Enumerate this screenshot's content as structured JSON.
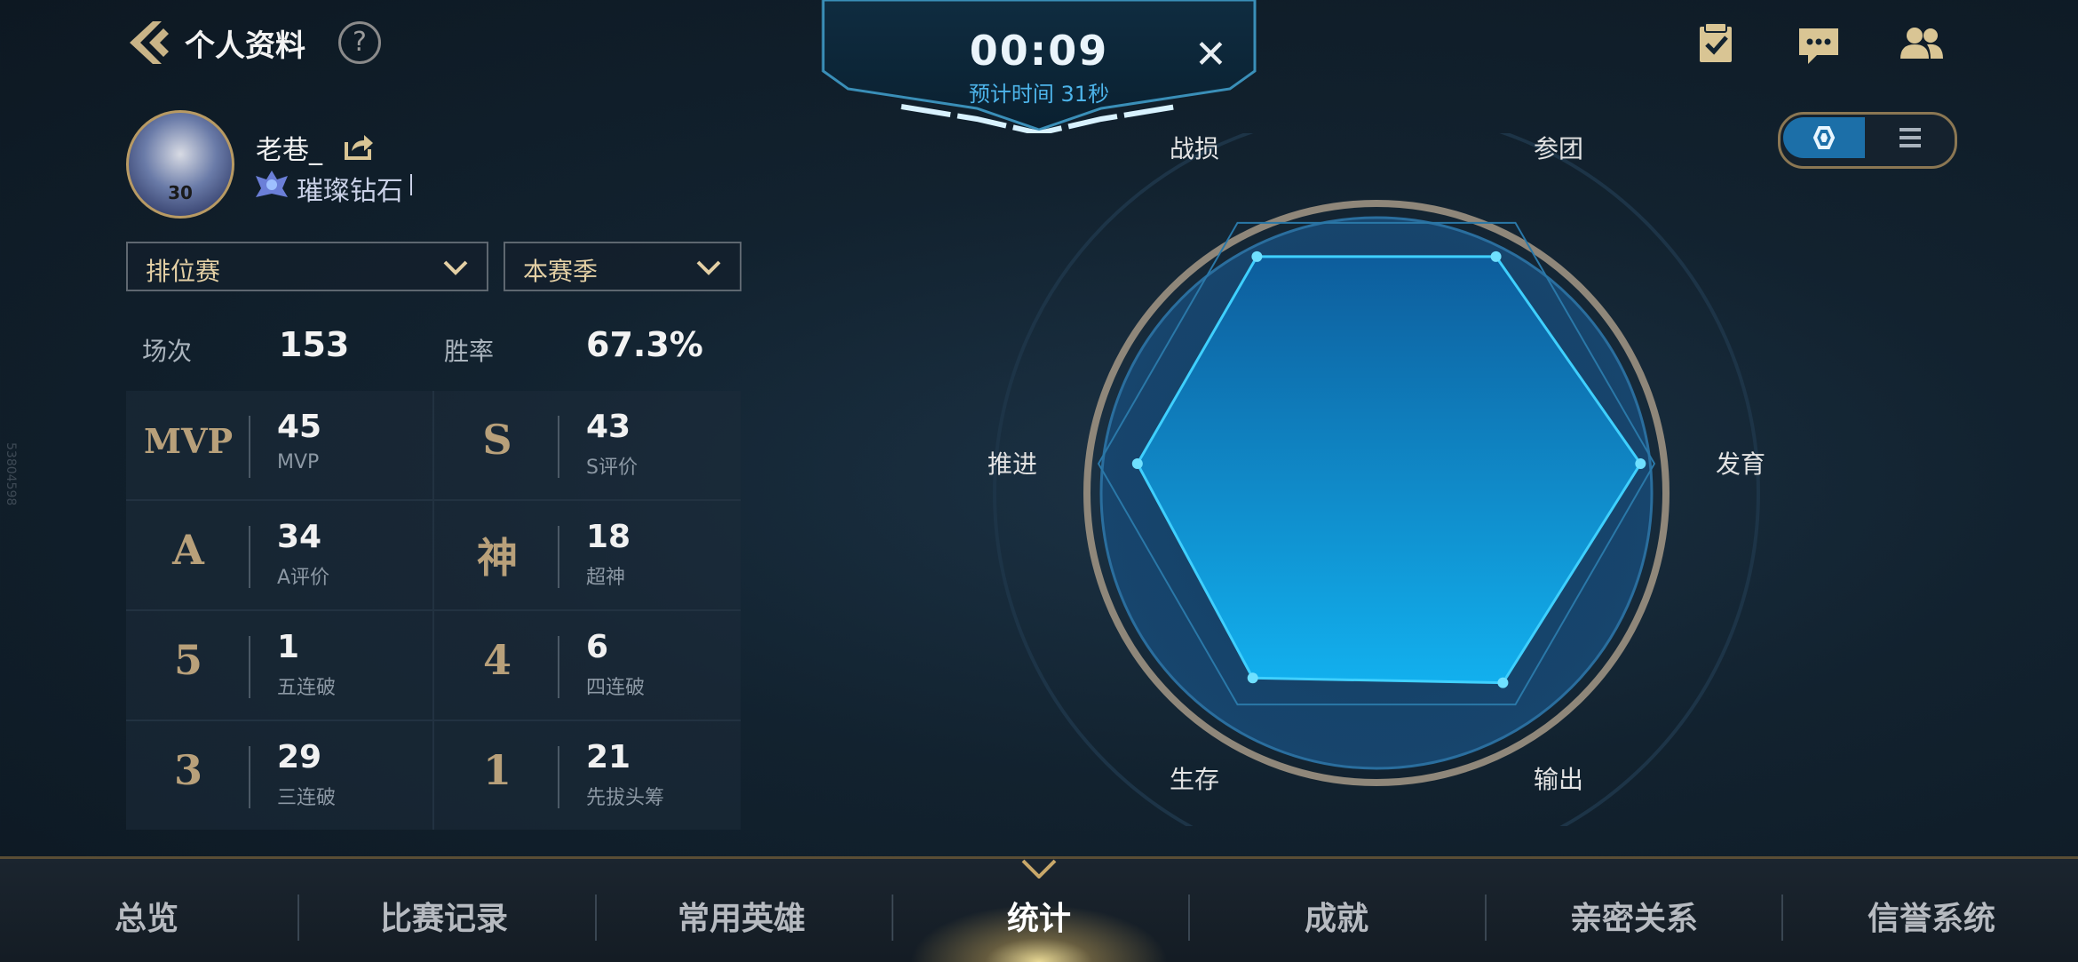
{
  "header": {
    "title": "个人资料",
    "help": "?"
  },
  "timer": {
    "time": "00:09",
    "estimate": "预计时间 31秒"
  },
  "profile": {
    "name": "老巷_",
    "rank": "璀璨钻石",
    "jersey": "30"
  },
  "filters": {
    "mode": "排位赛",
    "season": "本赛季"
  },
  "summary": {
    "matches_label": "场次",
    "matches": "153",
    "winrate_label": "胜率",
    "winrate": "67.3%"
  },
  "stats": [
    {
      "icon": "MVP",
      "value": "45",
      "label": "MVP"
    },
    {
      "icon": "S",
      "value": "43",
      "label": "S评价"
    },
    {
      "icon": "A",
      "value": "34",
      "label": "A评价"
    },
    {
      "icon": "神",
      "value": "18",
      "label": "超神"
    },
    {
      "icon": "5",
      "value": "1",
      "label": "五连破"
    },
    {
      "icon": "4",
      "value": "6",
      "label": "四连破"
    },
    {
      "icon": "3",
      "value": "29",
      "label": "三连破"
    },
    {
      "icon": "1",
      "value": "21",
      "label": "先拔头筹"
    }
  ],
  "radar": {
    "axes": [
      "参团",
      "发育",
      "输出",
      "生存",
      "推进",
      "战损"
    ],
    "values": [
      0.86,
      0.95,
      0.91,
      0.89,
      0.86,
      0.86
    ],
    "fill_color": "#1a9be0",
    "stroke_color": "#3fd0ff"
  },
  "view_toggle": {
    "selected": "radar"
  },
  "watermark": "53804598",
  "nav": {
    "tabs": [
      "总览",
      "比赛记录",
      "常用英雄",
      "统计",
      "成就",
      "亲密关系",
      "信誉系统"
    ],
    "active": "统计"
  }
}
